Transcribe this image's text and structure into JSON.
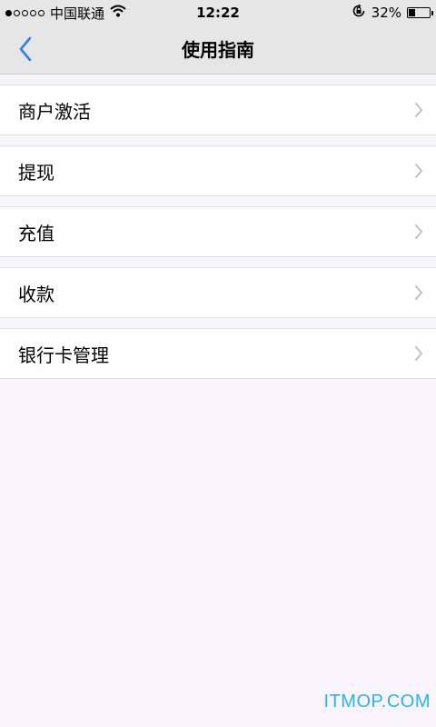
{
  "status_bar": {
    "carrier": "中国联通",
    "time": "12:22",
    "battery_percent": "32%",
    "battery_level": 0.32,
    "signal_filled": 1,
    "signal_total": 5
  },
  "nav": {
    "title": "使用指南",
    "back_icon": "chevron-left-icon",
    "accent_color": "#2f80e6"
  },
  "menu": {
    "items": [
      {
        "label": "商户激活",
        "icon": "chevron-right-icon"
      },
      {
        "label": "提现",
        "icon": "chevron-right-icon"
      },
      {
        "label": "充值",
        "icon": "chevron-right-icon"
      },
      {
        "label": "收款",
        "icon": "chevron-right-icon"
      },
      {
        "label": "银行卡管理",
        "icon": "chevron-right-icon"
      }
    ]
  },
  "watermark": {
    "text": "ITMOP.COM",
    "color": "#2fb0e8"
  }
}
